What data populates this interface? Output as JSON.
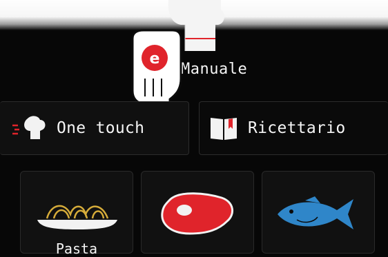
{
  "header": {
    "mode_label": "Manuale"
  },
  "tabs": [
    {
      "label": "One touch",
      "icon": "chef-hat-icon"
    },
    {
      "label": "Ricettario",
      "icon": "book-icon"
    }
  ],
  "categories": [
    {
      "label": "Pasta",
      "icon": "pasta-plate-icon"
    },
    {
      "label": "",
      "icon": "steak-icon"
    },
    {
      "label": "",
      "icon": "fish-icon"
    }
  ],
  "overlay": {
    "badge_letter": "e",
    "badge_color": "#e0242b"
  },
  "colors": {
    "accent_red": "#e0242b",
    "fish_blue": "#2f86c9",
    "pasta_gold": "#d6ac3a"
  }
}
